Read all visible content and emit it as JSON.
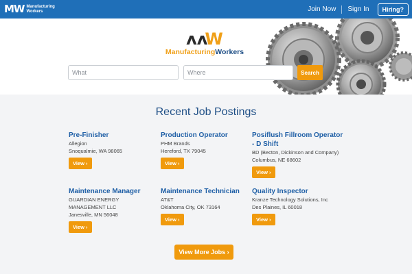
{
  "header": {
    "logo_mark": "MW",
    "logo_line1": "Manufacturing",
    "logo_line2": "Workers",
    "join_label": "Join Now",
    "signin_label": "Sign In",
    "hiring_label": "Hiring?"
  },
  "hero": {
    "logo_word1": "Manufacturing",
    "logo_word2": "Workers",
    "what_placeholder": "What",
    "where_placeholder": "Where",
    "search_label": "Search"
  },
  "postings": {
    "title": "Recent Job Postings",
    "jobs": [
      {
        "title": "Pre-Finisher",
        "company": "Allegion",
        "location": "Snoqualmie, WA 98065",
        "view_label": "View ›"
      },
      {
        "title": "Production Operator",
        "company": "PHM Brands",
        "location": "Hereford, TX 79045",
        "view_label": "View ›"
      },
      {
        "title": "Posiflush Fillroom Operator - D Shift",
        "company": "BD (Becton, Dickinson and Company)",
        "location": "Columbus, NE 68602",
        "view_label": "View ›"
      },
      {
        "title": "Maintenance Manager",
        "company": "GUARDIAN ENERGY MANAGEMENT LLC",
        "location": "Janesville, MN 56048",
        "view_label": "View ›"
      },
      {
        "title": "Maintenance Technician",
        "company": "AT&T",
        "location": "Oklahoma City, OK 73164",
        "view_label": "View ›"
      },
      {
        "title": "Quality Inspector",
        "company": "Kranze Technology Solutions, Inc",
        "location": "Des Plaines, IL 60018",
        "view_label": "View ›"
      }
    ],
    "view_more_label": "View More Jobs ›"
  },
  "colors": {
    "nav_blue": "#1f6fb8",
    "accent_orange": "#f09a0d",
    "title_blue": "#1f4f86"
  }
}
